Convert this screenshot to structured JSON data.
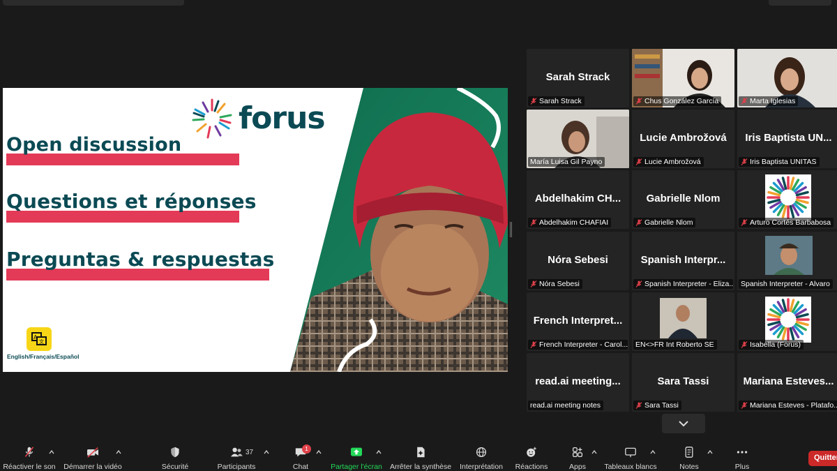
{
  "slide": {
    "brand": "forus",
    "lines": [
      "Open discussion",
      "Questions et réponses",
      "Preguntas & respuestas"
    ],
    "languages": "English/Français/Español"
  },
  "participants": [
    {
      "display": "Sarah Strack",
      "label": "Sarah Strack",
      "video": false,
      "muted": true
    },
    {
      "display": "",
      "label": "Chus González García",
      "video": true,
      "muted": true
    },
    {
      "display": "",
      "label": "Marta Iglesias",
      "video": true,
      "muted": true
    },
    {
      "display": "",
      "label": "María Luisa Gil Payno",
      "video": true,
      "muted": false,
      "active": true
    },
    {
      "display": "Lucie  Ambrožová",
      "label": "Lucie Ambrožová",
      "video": false,
      "muted": true
    },
    {
      "display": "Iris  Baptista  UN...",
      "label": "Iris Baptista UNITAS",
      "video": false,
      "muted": true
    },
    {
      "display": "Abdelhakim  CH...",
      "label": "Abdelhakim CHAFIAI",
      "video": false,
      "muted": true
    },
    {
      "display": "Gabrielle  Nlom",
      "label": "Gabrielle Nlom",
      "video": false,
      "muted": true
    },
    {
      "display": "",
      "label": "Arturo Cortés Barbabosa",
      "video": true,
      "logo": true,
      "muted": true
    },
    {
      "display": "Nóra  Sebesi",
      "label": "Nóra Sebesi",
      "video": false,
      "muted": true
    },
    {
      "display": "Spanish  Interpr...",
      "label": "Spanish Interpreter - Eliza...",
      "video": false,
      "muted": true
    },
    {
      "display": "",
      "label": "Spanish Interpreter - Alvaro",
      "video": true,
      "muted": false
    },
    {
      "display": "French  Interpret...",
      "label": "French Interpreter - Carol...",
      "video": false,
      "muted": true
    },
    {
      "display": "",
      "label": "EN<>FR Int Roberto SE",
      "video": true,
      "muted": false
    },
    {
      "display": "",
      "label": "Isabella (Forus)",
      "video": true,
      "logo": true,
      "muted": true
    },
    {
      "display": "read.ai  meeting...",
      "label": "read.ai meeting notes",
      "video": false,
      "muted": false
    },
    {
      "display": "Sara  Tassi",
      "label": "Sara Tassi",
      "video": false,
      "muted": true
    },
    {
      "display": "Mariana  Esteves...",
      "label": "Mariana Esteves - Platafo...",
      "video": false,
      "muted": true
    }
  ],
  "toolbar": {
    "unmute": "Réactiver le son",
    "start_video": "Démarrer la vidéo",
    "security": "Sécurité",
    "participants": "Participants",
    "participants_count": "37",
    "chat": "Chat",
    "chat_badge": "1",
    "share": "Partager l'écran",
    "stop_summary": "Arrêter la synthèse",
    "interpretation": "Interprétation",
    "reactions": "Réactions",
    "apps": "Apps",
    "whiteboards": "Tableaux blancs",
    "notes": "Notes",
    "more": "Plus",
    "quit": "Quitter"
  },
  "colors": {
    "accent_green": "#23d959",
    "quit_red": "#cc2929",
    "slide_teal": "#0b4a54",
    "slide_pink": "#e33a57",
    "active_speaker": "#d8e87a"
  }
}
